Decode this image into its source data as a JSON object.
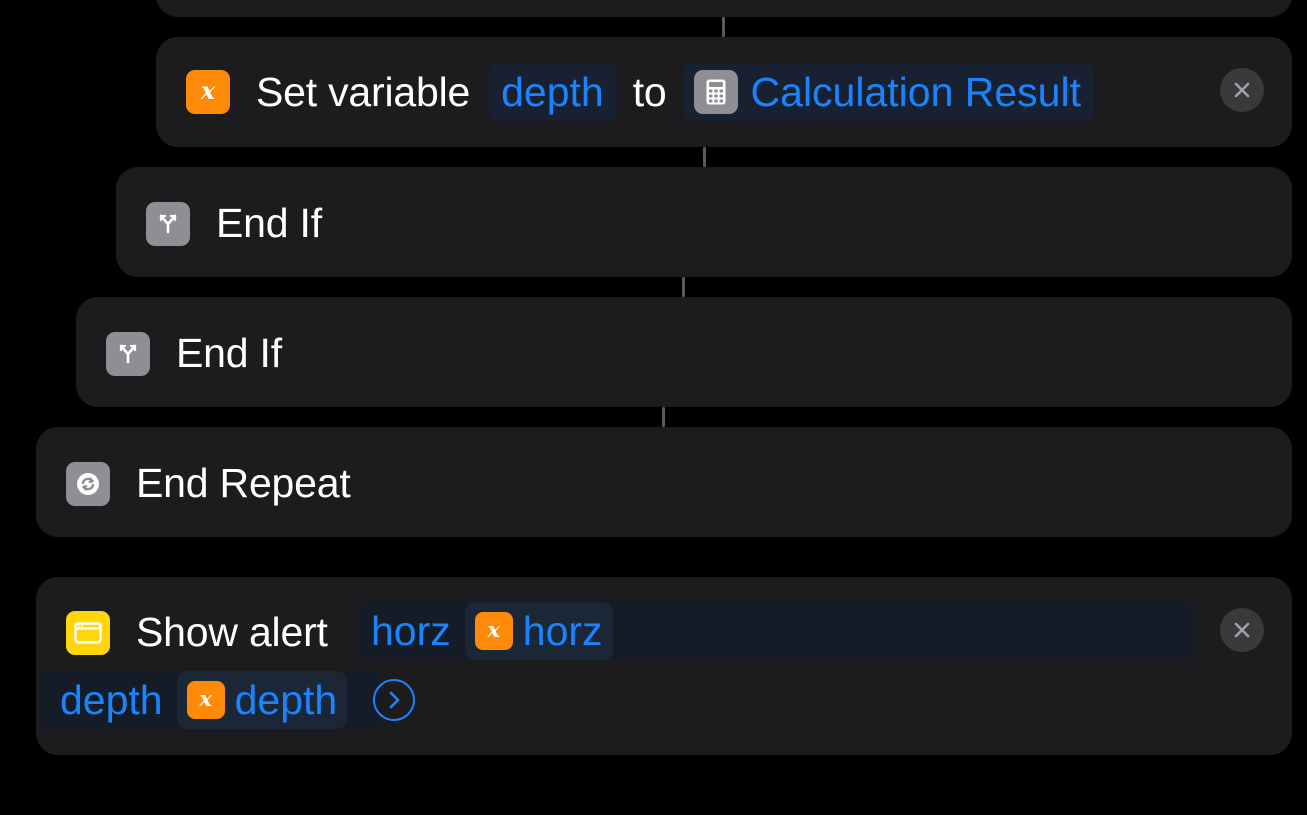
{
  "colors": {
    "background": "#000000",
    "card": "#1c1c1e",
    "accent_blue": "#1a84ff",
    "variable_orange": "#ff8a0a",
    "control_gray": "#8e8e93",
    "alert_yellow": "#ffd60a"
  },
  "actions": [
    {
      "kind": "set-variable",
      "icon": "variable-x-icon",
      "verb": "Set variable",
      "variable": "depth",
      "connector_word": "to",
      "value_icon": "calculator-icon",
      "value": "Calculation Result",
      "removable": true
    },
    {
      "kind": "end-if",
      "icon": "branch-icon",
      "label": "End If"
    },
    {
      "kind": "end-if",
      "icon": "branch-icon",
      "label": "End If"
    },
    {
      "kind": "end-repeat",
      "icon": "repeat-icon",
      "label": "End Repeat"
    },
    {
      "kind": "show-alert",
      "icon": "alert-window-icon",
      "verb": "Show alert",
      "message_line1": {
        "text": "horz",
        "variable": "horz"
      },
      "message_line2": {
        "text": "depth",
        "variable": "depth"
      },
      "more_icon": "chevron-right-circle-icon",
      "removable": true
    }
  ]
}
